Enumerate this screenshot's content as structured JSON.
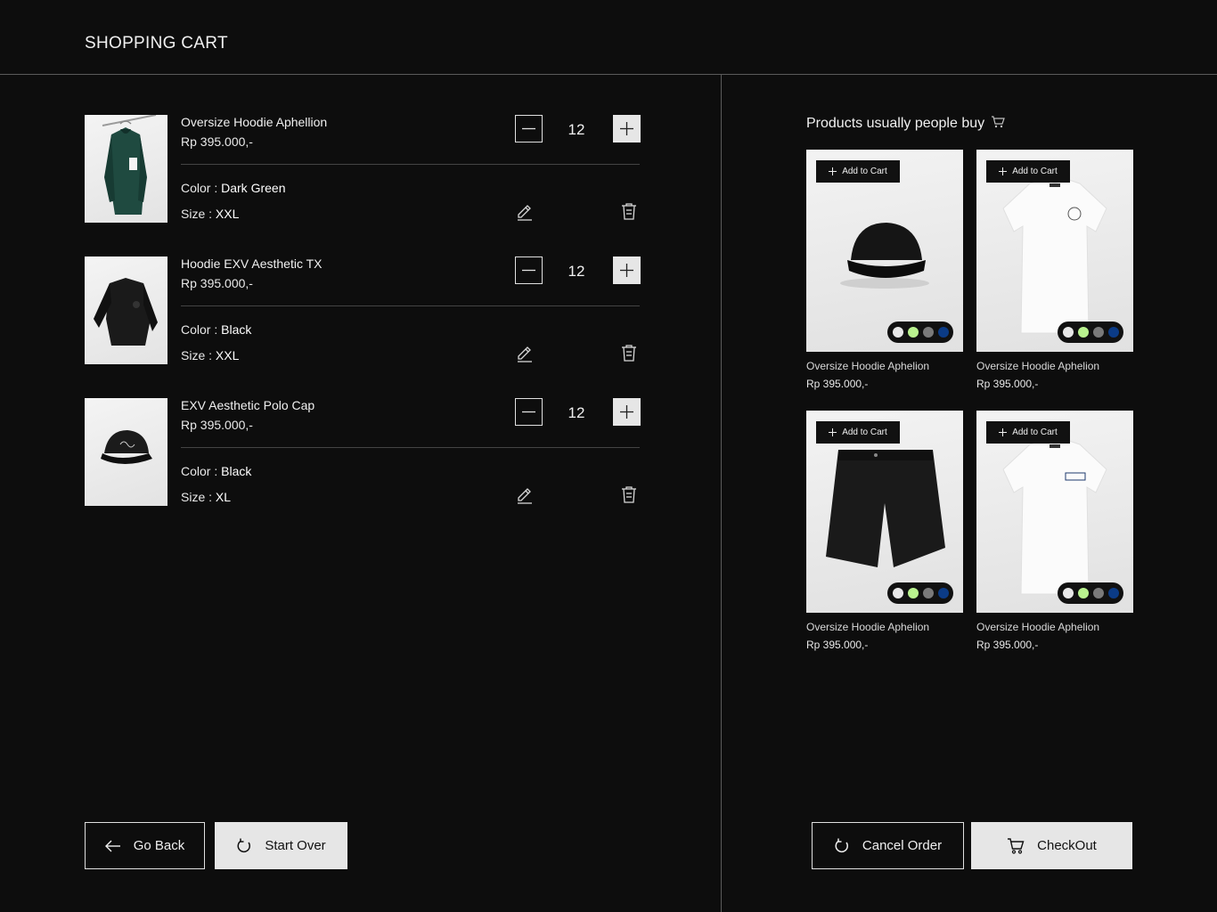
{
  "header": {
    "title": "SHOPPING CART"
  },
  "cart": {
    "color_label": "Color : ",
    "size_label": "Size : ",
    "items": [
      {
        "name": "Oversize Hoodie Aphellion",
        "price": "Rp 395.000,-",
        "quantity": "12",
        "color": "Dark Green",
        "size": "XXL",
        "image": "dark-green-hoodie"
      },
      {
        "name": "Hoodie EXV Aesthetic TX",
        "price": "Rp 395.000,-",
        "quantity": "12",
        "color": "Black",
        "size": "XXL",
        "image": "black-sweatshirt"
      },
      {
        "name": "EXV Aesthetic Polo Cap",
        "price": "Rp 395.000,-",
        "quantity": "12",
        "color": "Black",
        "size": "XL",
        "image": "black-cap"
      }
    ]
  },
  "footer_left": {
    "go_back": "Go Back",
    "start_over": "Start Over"
  },
  "footer_right": {
    "cancel_order": "Cancel Order",
    "checkout": "CheckOut"
  },
  "recommendations": {
    "title": "Products usually people buy",
    "add_label": "Add to Cart",
    "swatch_colors": [
      "#e8e8e8",
      "#b9f28f",
      "#7a7a7a",
      "#0b3b86"
    ],
    "products": [
      {
        "name": "Oversize Hoodie Aphelion",
        "price": "Rp 395.000,-",
        "image": "black-cap"
      },
      {
        "name": "Oversize Hoodie Aphelion",
        "price": "Rp 395.000,-",
        "image": "white-tshirt"
      },
      {
        "name": "Oversize Hoodie Aphelion",
        "price": "Rp 395.000,-",
        "image": "black-shorts"
      },
      {
        "name": "Oversize Hoodie Aphelion",
        "price": "Rp 395.000,-",
        "image": "white-tshirt-logo"
      }
    ]
  }
}
